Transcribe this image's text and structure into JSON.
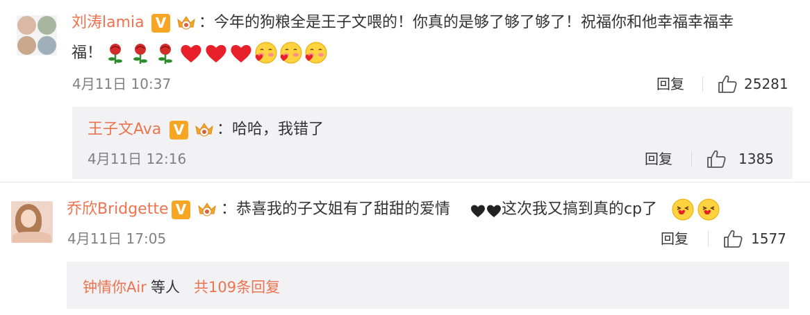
{
  "comments": [
    {
      "user": "刘涛lamia",
      "text_line1": "：今年的狗粮全是王子文喂的！你真的是够了够了够了！祝福你和他幸福幸福幸",
      "text_line2": "福！",
      "time": "4月11日 10:37",
      "reply_label": "回复",
      "likes": "25281",
      "emojis": [
        "rose-emoji",
        "rose-emoji",
        "rose-emoji",
        "heart-emoji",
        "heart-emoji",
        "heart-emoji",
        "blush-emoji",
        "blush-emoji",
        "blush-emoji"
      ],
      "nested_reply": {
        "user": "王子文Ava",
        "text": "：哈哈，我错了",
        "time": "4月11日 12:16",
        "reply_label": "回复",
        "likes": "1385"
      }
    },
    {
      "user": "乔欣Bridgette",
      "text_a": "：恭喜我的子文姐有了甜甜的爱情",
      "text_b": "这次我又搞到真的cp了",
      "time": "4月11日 17:05",
      "reply_label": "回复",
      "likes": "1577",
      "more_replies": {
        "user": "钟情你Air",
        "middle": " 等人 ",
        "count_text": "共109条回复"
      }
    }
  ],
  "colors": {
    "username": "#eb7350",
    "vip_badge": "#f6a623",
    "reply_background": "#f2f2f5",
    "text": "#333333",
    "meta": "#808080"
  }
}
